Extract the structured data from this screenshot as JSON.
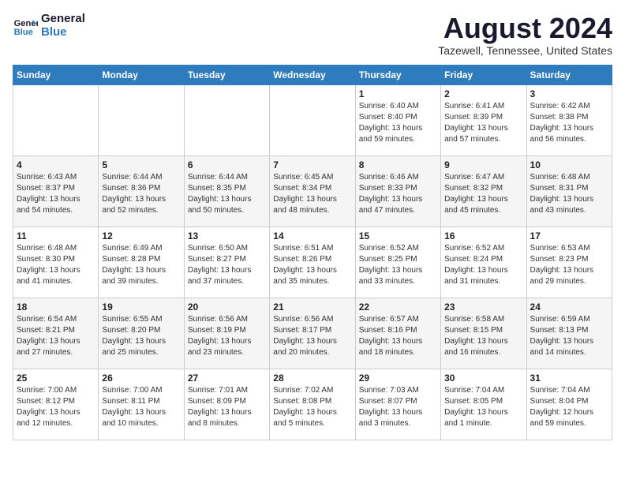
{
  "logo": {
    "text_general": "General",
    "text_blue": "Blue"
  },
  "header": {
    "title": "August 2024",
    "subtitle": "Tazewell, Tennessee, United States"
  },
  "columns": [
    "Sunday",
    "Monday",
    "Tuesday",
    "Wednesday",
    "Thursday",
    "Friday",
    "Saturday"
  ],
  "weeks": [
    [
      {
        "day": "",
        "info": ""
      },
      {
        "day": "",
        "info": ""
      },
      {
        "day": "",
        "info": ""
      },
      {
        "day": "",
        "info": ""
      },
      {
        "day": "1",
        "info": "Sunrise: 6:40 AM\nSunset: 8:40 PM\nDaylight: 13 hours\nand 59 minutes."
      },
      {
        "day": "2",
        "info": "Sunrise: 6:41 AM\nSunset: 8:39 PM\nDaylight: 13 hours\nand 57 minutes."
      },
      {
        "day": "3",
        "info": "Sunrise: 6:42 AM\nSunset: 8:38 PM\nDaylight: 13 hours\nand 56 minutes."
      }
    ],
    [
      {
        "day": "4",
        "info": "Sunrise: 6:43 AM\nSunset: 8:37 PM\nDaylight: 13 hours\nand 54 minutes."
      },
      {
        "day": "5",
        "info": "Sunrise: 6:44 AM\nSunset: 8:36 PM\nDaylight: 13 hours\nand 52 minutes."
      },
      {
        "day": "6",
        "info": "Sunrise: 6:44 AM\nSunset: 8:35 PM\nDaylight: 13 hours\nand 50 minutes."
      },
      {
        "day": "7",
        "info": "Sunrise: 6:45 AM\nSunset: 8:34 PM\nDaylight: 13 hours\nand 48 minutes."
      },
      {
        "day": "8",
        "info": "Sunrise: 6:46 AM\nSunset: 8:33 PM\nDaylight: 13 hours\nand 47 minutes."
      },
      {
        "day": "9",
        "info": "Sunrise: 6:47 AM\nSunset: 8:32 PM\nDaylight: 13 hours\nand 45 minutes."
      },
      {
        "day": "10",
        "info": "Sunrise: 6:48 AM\nSunset: 8:31 PM\nDaylight: 13 hours\nand 43 minutes."
      }
    ],
    [
      {
        "day": "11",
        "info": "Sunrise: 6:48 AM\nSunset: 8:30 PM\nDaylight: 13 hours\nand 41 minutes."
      },
      {
        "day": "12",
        "info": "Sunrise: 6:49 AM\nSunset: 8:28 PM\nDaylight: 13 hours\nand 39 minutes."
      },
      {
        "day": "13",
        "info": "Sunrise: 6:50 AM\nSunset: 8:27 PM\nDaylight: 13 hours\nand 37 minutes."
      },
      {
        "day": "14",
        "info": "Sunrise: 6:51 AM\nSunset: 8:26 PM\nDaylight: 13 hours\nand 35 minutes."
      },
      {
        "day": "15",
        "info": "Sunrise: 6:52 AM\nSunset: 8:25 PM\nDaylight: 13 hours\nand 33 minutes."
      },
      {
        "day": "16",
        "info": "Sunrise: 6:52 AM\nSunset: 8:24 PM\nDaylight: 13 hours\nand 31 minutes."
      },
      {
        "day": "17",
        "info": "Sunrise: 6:53 AM\nSunset: 8:23 PM\nDaylight: 13 hours\nand 29 minutes."
      }
    ],
    [
      {
        "day": "18",
        "info": "Sunrise: 6:54 AM\nSunset: 8:21 PM\nDaylight: 13 hours\nand 27 minutes."
      },
      {
        "day": "19",
        "info": "Sunrise: 6:55 AM\nSunset: 8:20 PM\nDaylight: 13 hours\nand 25 minutes."
      },
      {
        "day": "20",
        "info": "Sunrise: 6:56 AM\nSunset: 8:19 PM\nDaylight: 13 hours\nand 23 minutes."
      },
      {
        "day": "21",
        "info": "Sunrise: 6:56 AM\nSunset: 8:17 PM\nDaylight: 13 hours\nand 20 minutes."
      },
      {
        "day": "22",
        "info": "Sunrise: 6:57 AM\nSunset: 8:16 PM\nDaylight: 13 hours\nand 18 minutes."
      },
      {
        "day": "23",
        "info": "Sunrise: 6:58 AM\nSunset: 8:15 PM\nDaylight: 13 hours\nand 16 minutes."
      },
      {
        "day": "24",
        "info": "Sunrise: 6:59 AM\nSunset: 8:13 PM\nDaylight: 13 hours\nand 14 minutes."
      }
    ],
    [
      {
        "day": "25",
        "info": "Sunrise: 7:00 AM\nSunset: 8:12 PM\nDaylight: 13 hours\nand 12 minutes."
      },
      {
        "day": "26",
        "info": "Sunrise: 7:00 AM\nSunset: 8:11 PM\nDaylight: 13 hours\nand 10 minutes."
      },
      {
        "day": "27",
        "info": "Sunrise: 7:01 AM\nSunset: 8:09 PM\nDaylight: 13 hours\nand 8 minutes."
      },
      {
        "day": "28",
        "info": "Sunrise: 7:02 AM\nSunset: 8:08 PM\nDaylight: 13 hours\nand 5 minutes."
      },
      {
        "day": "29",
        "info": "Sunrise: 7:03 AM\nSunset: 8:07 PM\nDaylight: 13 hours\nand 3 minutes."
      },
      {
        "day": "30",
        "info": "Sunrise: 7:04 AM\nSunset: 8:05 PM\nDaylight: 13 hours\nand 1 minute."
      },
      {
        "day": "31",
        "info": "Sunrise: 7:04 AM\nSunset: 8:04 PM\nDaylight: 12 hours\nand 59 minutes."
      }
    ]
  ]
}
